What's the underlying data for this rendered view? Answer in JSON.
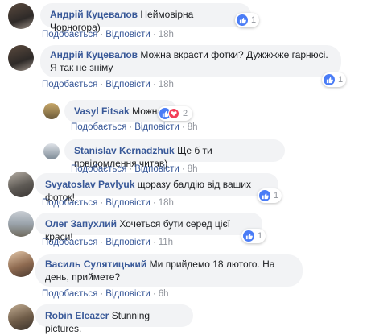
{
  "comments": [
    {
      "author": "Андрій Куцевалов",
      "text": "Неймовірна Чорногора)",
      "like": "Подобається",
      "reply": "Відповісти",
      "time": "18h",
      "reactions": "1"
    },
    {
      "author": "Андрій Куцевалов",
      "text": "Можна вкрасти фотки? Дужжжже гарнюсі. Я так не зніму",
      "like": "Подобається",
      "reply": "Відповісти",
      "time": "18h",
      "reactions": "1"
    },
    {
      "author": "Vasyl Fitsak",
      "text": "Можна",
      "like": "Подобається",
      "reply": "Відповісти",
      "time": "8h",
      "reactions": "2"
    },
    {
      "author": "Stanislav Kernadzhuk",
      "text": "Ще б ти повідомлення читав)",
      "like": "Подобається",
      "reply": "Відповісти",
      "time": "8h"
    },
    {
      "author": "Svyatoslav Pavlyuk",
      "text": "щоразу балдію від ваших фоток!",
      "like": "Подобається",
      "reply": "Відповісти",
      "time": "18h",
      "reactions": "1"
    },
    {
      "author": "Олег Запухлий",
      "text": "Хочеться бути серед цієї краси!",
      "like": "Подобається",
      "reply": "Відповісти",
      "time": "11h",
      "reactions": "1"
    },
    {
      "author": "Василь Сулятицький",
      "text": "Ми прийдемо 18 лютого. На день, приймете?",
      "like": "Подобається",
      "reply": "Відповісти",
      "time": "6h"
    },
    {
      "author": "Robin Eleazer",
      "text": "Stunning pictures."
    }
  ],
  "colors": {
    "link": "#385898",
    "bubble": "#f2f3f5",
    "meta_gray": "#90949c",
    "like_blue": "#4a7cf6",
    "love_red": "#f33e58"
  },
  "icons": {
    "like": "thumbs-up-icon",
    "love": "heart-icon"
  }
}
